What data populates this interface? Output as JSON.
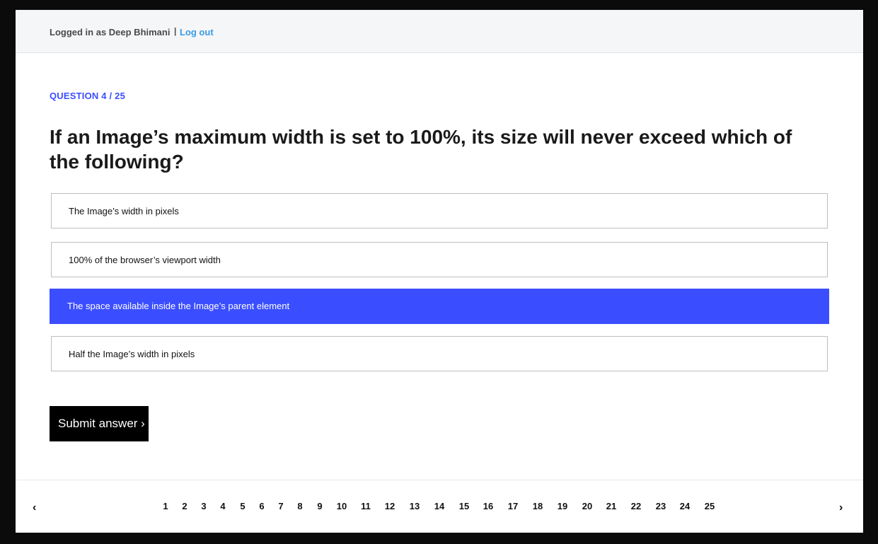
{
  "header": {
    "login_text": "Logged in as Deep Bhimani",
    "separator": "|",
    "logout_label": "Log out"
  },
  "quiz": {
    "counter": "QUESTION 4 / 25",
    "question": "If an Image’s maximum width is set to 100%, its size will never exceed which of the following?",
    "answers": [
      {
        "label": "The Image’s width in pixels",
        "selected": false
      },
      {
        "label": "100% of the browser’s viewport width",
        "selected": false
      },
      {
        "label": "The space available inside the Image’s parent element",
        "selected": true
      },
      {
        "label": "Half the Image’s width in pixels",
        "selected": false
      }
    ],
    "submit_label": "Submit answer ›"
  },
  "pagination": {
    "prev_icon": "‹",
    "next_icon": "›",
    "pages": [
      "1",
      "2",
      "3",
      "4",
      "5",
      "6",
      "7",
      "8",
      "9",
      "10",
      "11",
      "12",
      "13",
      "14",
      "15",
      "16",
      "17",
      "18",
      "19",
      "20",
      "21",
      "22",
      "23",
      "24",
      "25"
    ]
  },
  "colors": {
    "accent": "#3b4eff",
    "link": "#3a9ae6",
    "submit_bg": "#000000"
  }
}
